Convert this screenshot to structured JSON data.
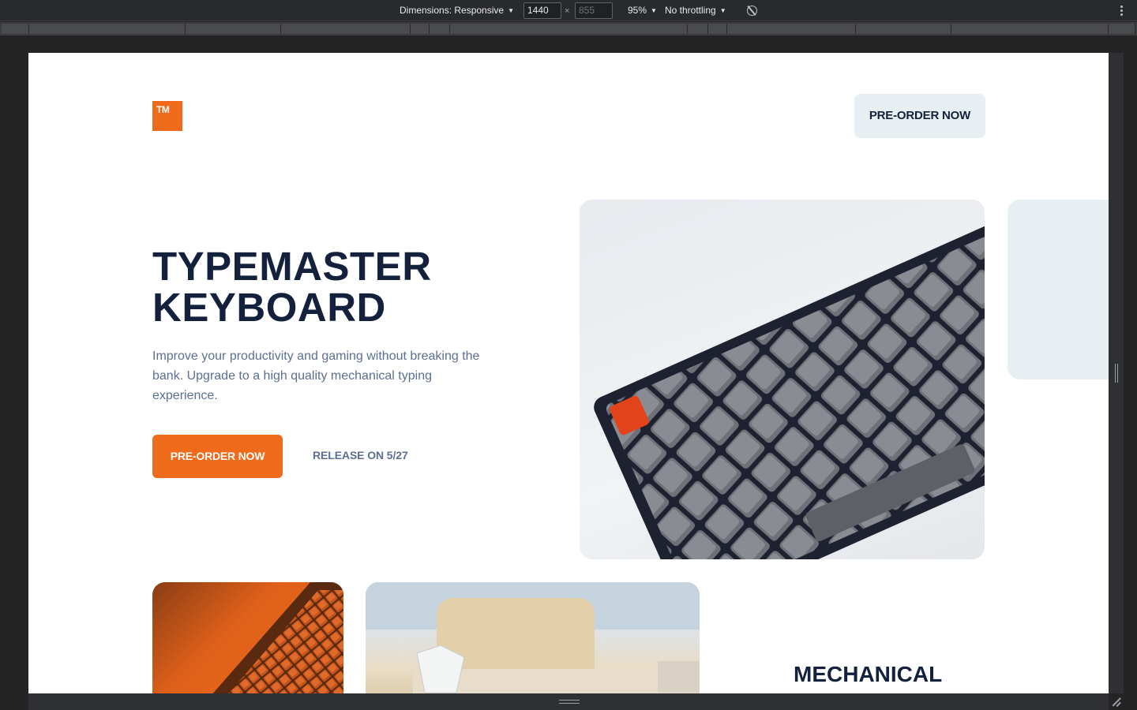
{
  "devtools": {
    "dimensions_label": "Dimensions: Responsive",
    "width_value": "1440",
    "height_value": "855",
    "zoom": "95%",
    "throttling": "No throttling"
  },
  "site": {
    "logo_text": "TM",
    "nav_cta": "PRE-ORDER NOW",
    "hero": {
      "title_line1": "TYPEMASTER",
      "title_line2": "KEYBOARD",
      "description": "Improve your productivity and gaming without breaking the bank. Upgrade to a high quality mechanical typing experience.",
      "cta": "PRE-ORDER NOW",
      "release": "RELEASE ON 5/27"
    },
    "features": {
      "heading": "MECHANICAL"
    }
  },
  "colors": {
    "accent": "#f06a1b",
    "navy": "#13213d",
    "muted_text": "#5b6f94",
    "light_bg": "#e8eff3"
  }
}
